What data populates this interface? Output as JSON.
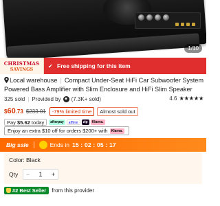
{
  "gallery": {
    "counter": "1/10"
  },
  "promo": {
    "badge_line1": "CHRISTMAS",
    "badge_line2": "SAVINGS",
    "shipping_text": "Free shipping for this item"
  },
  "product": {
    "title_line1_location": "Local warehouse",
    "title_line1_rest": "Compact Under-Seat HiFi Car Subwoofer System -",
    "title_line2": "Powered Bass Amplifier with Slim Enclosure and HiFi Slim Speaker"
  },
  "sold": {
    "count": "325 sold",
    "provided_by": "Provided by",
    "seller_sold": "(7.3K+ sold)",
    "rating": "4.6",
    "stars": "★★★★★"
  },
  "price": {
    "currency": "$",
    "whole": "60",
    "cents": ".73",
    "original": "$233.01",
    "discount": "-79% limited time",
    "stock_badge": "Almost sold out"
  },
  "pay": {
    "label": "Pay ",
    "amount": "$5.62",
    "suffix": " today",
    "logos": [
      "afterpay",
      "affirm",
      "zip",
      "Klarna."
    ]
  },
  "extra": {
    "text": "Enjoy an extra $10 off for orders $200+ with",
    "logo": "Klarna."
  },
  "sale": {
    "label": "Big sale",
    "ends_label": "Ends in",
    "timer": "15 : 02 : 05 : 17"
  },
  "options": {
    "color_label": "Color: Black",
    "qty_label": "Qty",
    "minus": "−",
    "qty_value": "1",
    "plus": "+"
  },
  "best": {
    "badge": "#2 Best Seller",
    "text": "from this provider"
  },
  "colors": {
    "accent": "#d83200",
    "promo_red": "#e02d2d",
    "sale_orange": "#ff6a00",
    "best_green": "#0a8a2a"
  }
}
